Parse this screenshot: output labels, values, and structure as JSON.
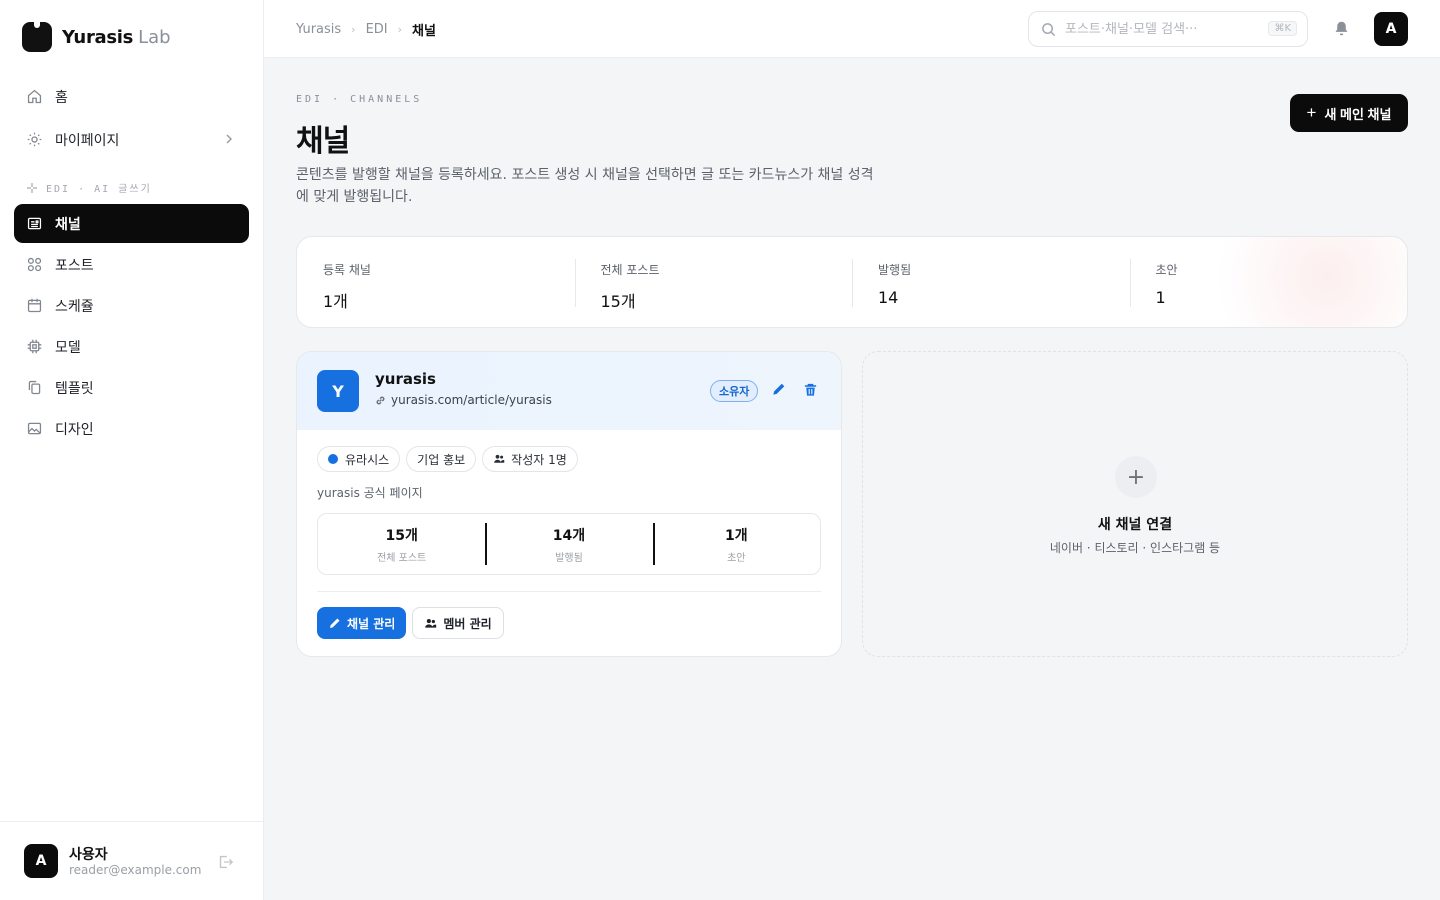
{
  "brand": {
    "name": "Yurasis",
    "suffix": "Lab"
  },
  "sidebar": {
    "items": [
      {
        "label": "홈",
        "icon": "home-icon"
      },
      {
        "label": "마이페이지",
        "icon": "gear-icon"
      }
    ],
    "section_label": "EDI · AI 글쓰기",
    "edi_items": [
      {
        "label": "채널",
        "icon": "newspaper-icon",
        "active": true
      },
      {
        "label": "포스트",
        "icon": "grid-icon"
      },
      {
        "label": "스케쥴",
        "icon": "calendar-icon"
      },
      {
        "label": "모델",
        "icon": "chip-icon"
      },
      {
        "label": "템플릿",
        "icon": "copy-icon"
      },
      {
        "label": "디자인",
        "icon": "image-icon"
      }
    ],
    "user": {
      "initial": "A",
      "name": "사용자",
      "email": "reader@example.com"
    }
  },
  "topbar": {
    "breadcrumb": [
      "Yurasis",
      "EDI",
      "채널"
    ],
    "search_placeholder": "포스트·채널·모델 검색···",
    "search_shortcut": "⌘K",
    "avatar_initial": "A"
  },
  "page": {
    "eyebrow": "EDI · CHANNELS",
    "title": "채널",
    "description": "콘텐츠를 발행할 채널을 등록하세요. 포스트 생성 시 채널을 선택하면 글 또는 카드뉴스가 채널 성격에 맞게 발행됩니다.",
    "new_button": "새 메인 채널"
  },
  "stats": [
    {
      "label": "등록 채널",
      "value": "1개"
    },
    {
      "label": "전체 포스트",
      "value": "15개"
    },
    {
      "label": "발행됨",
      "value": "14"
    },
    {
      "label": "초안",
      "value": "1"
    }
  ],
  "channel": {
    "initial": "Y",
    "name": "yurasis",
    "url": "yurasis.com/article/yurasis",
    "role_badge": "소유자",
    "chips": {
      "brand": "유라시스",
      "category": "기업 홍보",
      "writers": "작성자 1명"
    },
    "description": "yurasis 공식 페이지",
    "mini_stats": [
      {
        "value": "15개",
        "label": "전체 포스트"
      },
      {
        "value": "14개",
        "label": "발행됨"
      },
      {
        "value": "1개",
        "label": "초안"
      }
    ],
    "manage_button": "채널 관리",
    "members_button": "멤버 관리",
    "accent_color": "#1670e0"
  },
  "add_card": {
    "title": "새 채널 연결",
    "subtitle": "네이버 · 티스토리 · 인스타그램 등"
  }
}
